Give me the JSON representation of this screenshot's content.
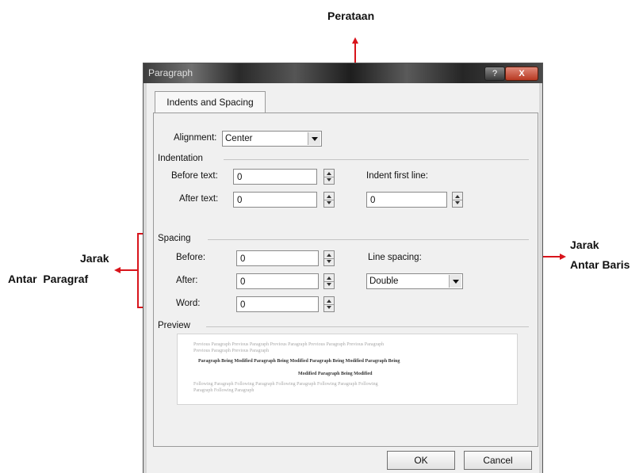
{
  "annotations": {
    "alignment_callout": "Perataan",
    "line_spacing_callout": [
      "Jarak",
      "Antar Baris"
    ],
    "paragraph_spacing_callout": [
      "Jarak",
      "Antar  Paragraf"
    ],
    "callout_color": "#d8141b"
  },
  "dialog": {
    "title": "Paragraph",
    "help_label": "?",
    "close_label": "X",
    "tab_label": "Indents and Spacing",
    "alignment": {
      "label": "Alignment:",
      "value": "Center"
    },
    "indentation": {
      "heading": "Indentation",
      "before_text_label": "Before text:",
      "before_text_value": "0",
      "after_text_label": "After text:",
      "after_text_value": "0",
      "first_line_label": "Indent first line:",
      "first_line_value": "0"
    },
    "spacing": {
      "heading": "Spacing",
      "before_label": "Before:",
      "before_value": "0",
      "after_label": "After:",
      "after_value": "0",
      "word_label": "Word:",
      "word_value": "0",
      "line_spacing_label": "Line spacing:",
      "line_spacing_value": "Double"
    },
    "preview": {
      "heading": "Preview",
      "lines": [
        "Previous Paragraph Previous Paragraph Previous Paragraph Previous Paragraph Previous Paragraph",
        "Previous Paragraph Previous Paragraph",
        "Paragraph Being Modified Paragraph Being Modified Paragraph Being Modified Paragraph Being",
        "Modified Paragraph Being Modified",
        "Following Paragraph Following Paragraph Following Paragraph Following Paragraph Following",
        "Paragraph Following Paragraph"
      ]
    },
    "ok_label": "OK",
    "cancel_label": "Cancel"
  }
}
